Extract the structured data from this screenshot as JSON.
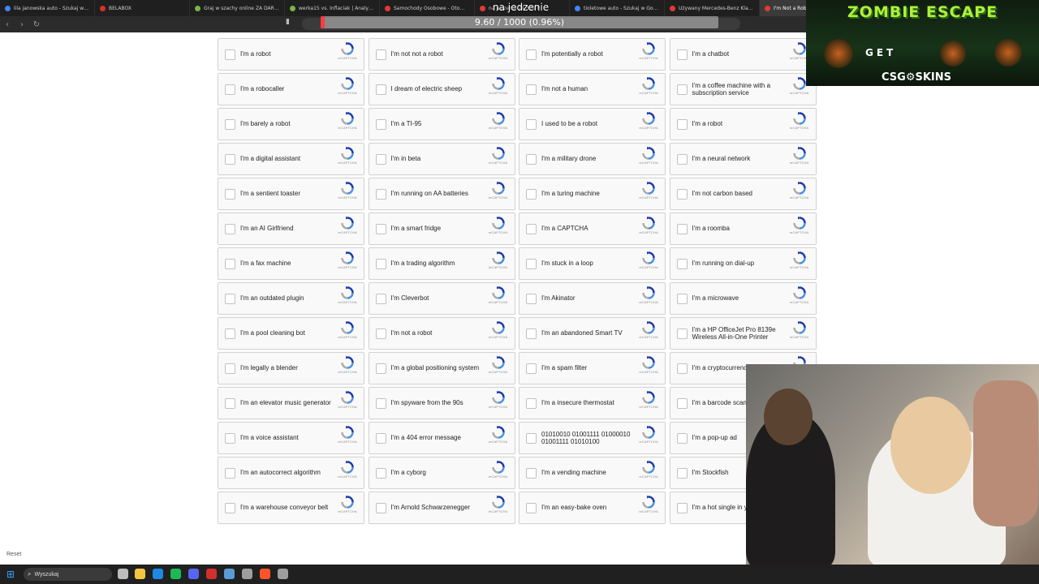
{
  "browser": {
    "tabs": [
      {
        "title": "lila janowska auto - Szukaj w Goo",
        "color": "#4285f4"
      },
      {
        "title": "BELABOX",
        "color": "#d93025"
      },
      {
        "title": "Graj w szachy online ZA DARMO -",
        "color": "#7cb342"
      },
      {
        "title": "werka15 vs. Inflaciak | Analysis - Ch",
        "color": "#7cb342"
      },
      {
        "title": "Samochody Osobowe - Otomoto",
        "color": "#e53935"
      },
      {
        "title": "na jedzenie 24 320 P",
        "color": "#e53935"
      },
      {
        "title": "tioletowe auto - Szukaj w Google",
        "color": "#4285f4"
      },
      {
        "title": "Używany Mercedes-Benz Klasa A",
        "color": "#e53935"
      },
      {
        "title": "I'm Not a Robot",
        "color": "#e53935"
      }
    ]
  },
  "stream_overlay": {
    "title": "na jedzenie",
    "progress_text": "9.60 / 1000 (0.96%)",
    "progress_fraction": 0.0096
  },
  "captchas": [
    "I'm a robot",
    "I'm not not a robot",
    "I'm potentially a robot",
    "I'm a chatbot",
    "I'm a robocaller",
    "I dream of electric sheep",
    "I'm not a human",
    "I'm a coffee machine with a subscription service",
    "I'm barely a robot",
    "I'm a TI-95",
    "I used to be a robot",
    "I'm a robot",
    "I'm a digital assistant",
    "I'm in beta",
    "I'm a military drone",
    "I'm a neural network",
    "I'm a sentient toaster",
    "I'm running on AA batteries",
    "I'm a turing machine",
    "I'm not carbon based",
    "I'm an AI Girlfriend",
    "I'm a smart fridge",
    "I'm a CAPTCHA",
    "I'm a roomba",
    "I'm a fax machine",
    "I'm a trading algorithm",
    "I'm stuck in a loop",
    "I'm running on dial-up",
    "I'm an outdated plugin",
    "I'm Cleverbot",
    "I'm Akinator",
    "I'm a microwave",
    "I'm a pool cleaning bot",
    "I'm not a robot",
    "I'm an abandoned Smart TV",
    "I'm a HP OfficeJet Pro 8139e Wireless All-in-One Printer",
    "I'm legally a blender",
    "I'm a global positioning system",
    "I'm a spam filter",
    "I'm a cryptocurrency",
    "I'm an elevator music generator",
    "I'm spyware from the 90s",
    "I'm a insecure thermostat",
    "I'm a barcode scanner",
    "I'm a voice assistant",
    "I'm a 404 error message",
    "01010010 01001111 01000010 01001111 01010100",
    "I'm a pop-up ad",
    "I'm an autocorrect algorithm",
    "I'm a cyborg",
    "I'm a vending machine",
    "I'm Stockfish",
    "I'm a warehouse conveyor belt",
    "I'm Arnold Schwarzenegger",
    "I'm an easy-bake oven",
    "I'm a hot single in your area"
  ],
  "recaptcha_text": "reCAPTCHA",
  "reset_label": "Reset",
  "taskbar": {
    "search_placeholder": "Wyszukaj",
    "icons": [
      {
        "name": "task-view-icon",
        "color": "#bdbdbd"
      },
      {
        "name": "file-explorer-icon",
        "color": "#f5c542"
      },
      {
        "name": "store-icon",
        "color": "#1e88e5"
      },
      {
        "name": "spotify-icon",
        "color": "#1db954"
      },
      {
        "name": "discord-icon",
        "color": "#5865f2"
      },
      {
        "name": "app-red-icon",
        "color": "#d32f2f"
      },
      {
        "name": "steam-icon",
        "color": "#5b9bd5"
      },
      {
        "name": "obs-icon",
        "color": "#9e9e9e"
      },
      {
        "name": "brave-icon",
        "color": "#fb542b"
      },
      {
        "name": "settings-icon",
        "color": "#9e9e9e"
      }
    ]
  },
  "ad": {
    "title": "ZOMBIE ESCAPE",
    "get": "GET",
    "brand": "CSG⚙SKINS"
  }
}
